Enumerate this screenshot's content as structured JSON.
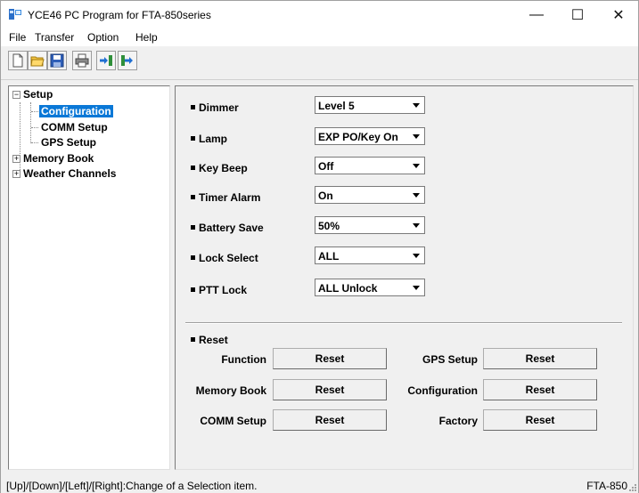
{
  "window": {
    "title": "YCE46 PC Program for FTA-850series",
    "minimize": "—",
    "maximize": "☐",
    "close": "✕"
  },
  "menu": [
    {
      "label": "File"
    },
    {
      "label": "Transfer"
    },
    {
      "label": "Option"
    },
    {
      "label": "Help"
    }
  ],
  "toolbar": {
    "icons": [
      "new-file-icon",
      "open-folder-icon",
      "save-icon",
      "print-icon",
      "read-from-radio-icon",
      "write-to-radio-icon"
    ]
  },
  "tree": {
    "setup": "Setup",
    "configuration": "Configuration",
    "comm_setup": "COMM Setup",
    "gps_setup": "GPS Setup",
    "memory_book": "Memory Book",
    "weather_channels": "Weather Channels",
    "collapse_symbol": "−",
    "expand_symbol": "+"
  },
  "settings": [
    {
      "label": "Dimmer",
      "value": "Level 5"
    },
    {
      "label": "Lamp",
      "value": "EXP PO/Key On"
    },
    {
      "label": "Key Beep",
      "value": "Off"
    },
    {
      "label": "Timer Alarm",
      "value": "On"
    },
    {
      "label": "Battery Save",
      "value": "50%"
    },
    {
      "label": "Lock Select",
      "value": "ALL"
    },
    {
      "label": "PTT Lock",
      "value": "ALL Unlock"
    }
  ],
  "reset": {
    "title": "Reset",
    "button_label": "Reset",
    "items": [
      {
        "label": "Function"
      },
      {
        "label": "GPS Setup"
      },
      {
        "label": "Memory Book"
      },
      {
        "label": "Configuration"
      },
      {
        "label": "COMM Setup"
      },
      {
        "label": "Factory"
      }
    ]
  },
  "status": {
    "text": "[Up]/[Down]/[Left]/[Right]:Change of a Selection item.",
    "model": "FTA-850"
  },
  "colors": {
    "selection": "#0a78d7"
  }
}
